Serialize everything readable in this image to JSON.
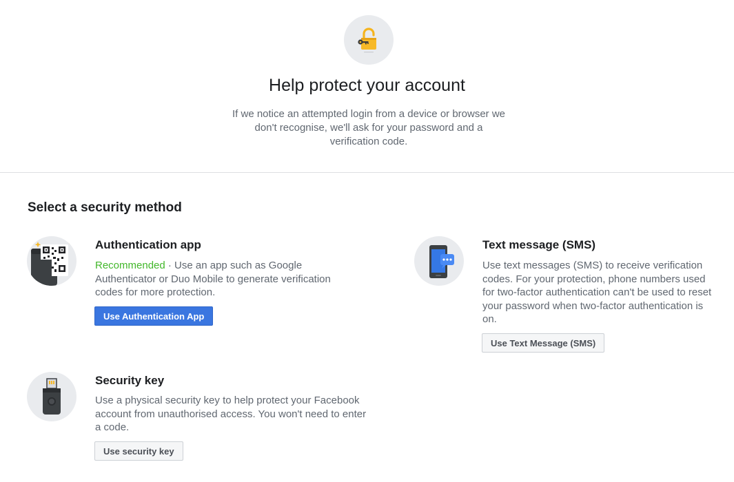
{
  "header": {
    "icon": "padlock-key-icon",
    "title": "Help protect your account",
    "description": "If we notice an attempted login from a device or browser we don't recognise, we'll ask for your password and a verification code."
  },
  "section": {
    "title": "Select a security method"
  },
  "methods": {
    "auth_app": {
      "icon": "authenticator-qr-icon",
      "title": "Authentication app",
      "recommended": "Recommended",
      "description": " · Use an app such as Google Authenticator or Duo Mobile to generate verification codes for more protection.",
      "button": "Use Authentication App"
    },
    "sms": {
      "icon": "phone-message-icon",
      "title": "Text message (SMS)",
      "description": "Use text messages (SMS) to receive verification codes. For your protection, phone numbers used for two-factor authentication can't be used to reset your password when two-factor authentication is on.",
      "button": "Use Text Message (SMS)"
    },
    "security_key": {
      "icon": "usb-security-key-icon",
      "title": "Security key",
      "description": "Use a physical security key to help protect your Facebook account from unauthorised access. You won't need to enter a code.",
      "button": "Use security key"
    }
  },
  "colors": {
    "primary_button": "#3a76e0",
    "recommended": "#42b72a",
    "icon_circle": "#e9ebee"
  }
}
